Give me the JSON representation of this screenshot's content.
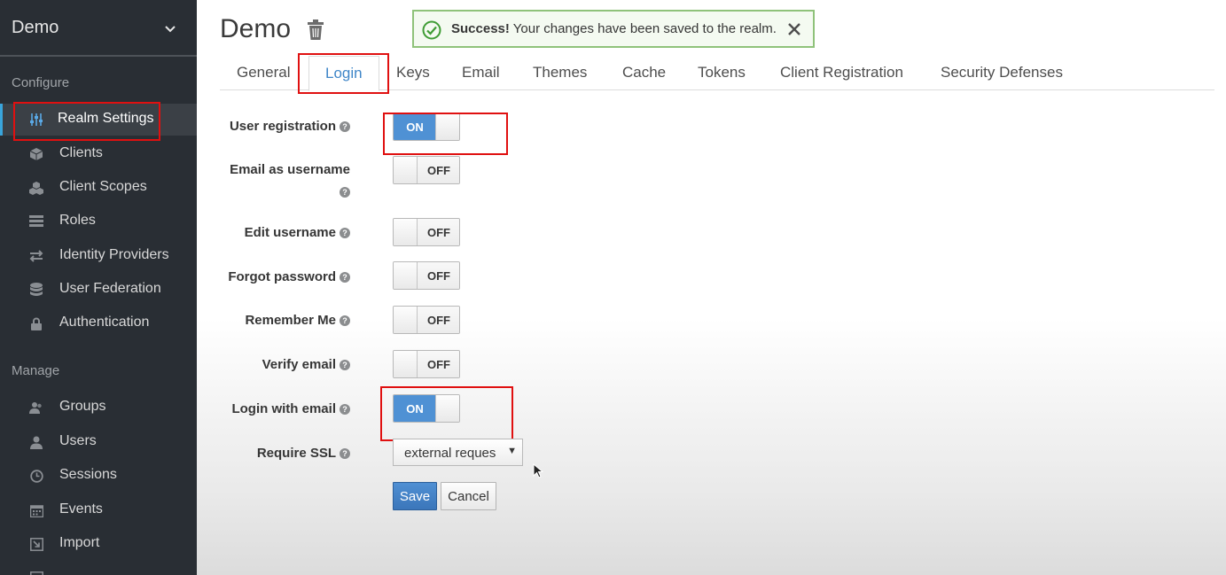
{
  "sidebar": {
    "realm_name": "Demo",
    "sections": {
      "configure": "Configure",
      "manage": "Manage"
    },
    "configure_items": [
      {
        "label": "Realm Settings",
        "icon": "sliders-icon",
        "active": true
      },
      {
        "label": "Clients",
        "icon": "cube-icon"
      },
      {
        "label": "Client Scopes",
        "icon": "cubes-icon"
      },
      {
        "label": "Roles",
        "icon": "list-icon"
      },
      {
        "label": "Identity Providers",
        "icon": "exchange-icon"
      },
      {
        "label": "User Federation",
        "icon": "database-icon"
      },
      {
        "label": "Authentication",
        "icon": "lock-icon"
      }
    ],
    "manage_items": [
      {
        "label": "Groups",
        "icon": "users-icon"
      },
      {
        "label": "Users",
        "icon": "user-icon"
      },
      {
        "label": "Sessions",
        "icon": "clock-icon"
      },
      {
        "label": "Events",
        "icon": "calendar-icon"
      },
      {
        "label": "Import",
        "icon": "import-icon"
      }
    ]
  },
  "header": {
    "title": "Demo",
    "alert": {
      "strong": "Success!",
      "message": " Your changes have been saved to the realm."
    }
  },
  "tabs": [
    "General",
    "Login",
    "Keys",
    "Email",
    "Themes",
    "Cache",
    "Tokens",
    "Client Registration",
    "Security Defenses"
  ],
  "active_tab": "Login",
  "form": {
    "fields": [
      {
        "label": "User registration",
        "value": "ON"
      },
      {
        "label_line1": "Email as username",
        "value": "OFF"
      },
      {
        "label": "Edit username",
        "value": "OFF"
      },
      {
        "label": "Forgot password",
        "value": "OFF"
      },
      {
        "label": "Remember Me",
        "value": "OFF"
      },
      {
        "label": "Verify email",
        "value": "OFF"
      },
      {
        "label": "Login with email",
        "value": "ON"
      }
    ],
    "require_ssl": {
      "label": "Require SSL",
      "value": "external reques"
    },
    "help_glyph": "?",
    "save_label": "Save",
    "cancel_label": "Cancel"
  },
  "colors": {
    "sidebar_bg": "#292e34",
    "accent_blue": "#4f91d4",
    "success_border": "#8fc27a",
    "highlight_red": "#e01010"
  }
}
